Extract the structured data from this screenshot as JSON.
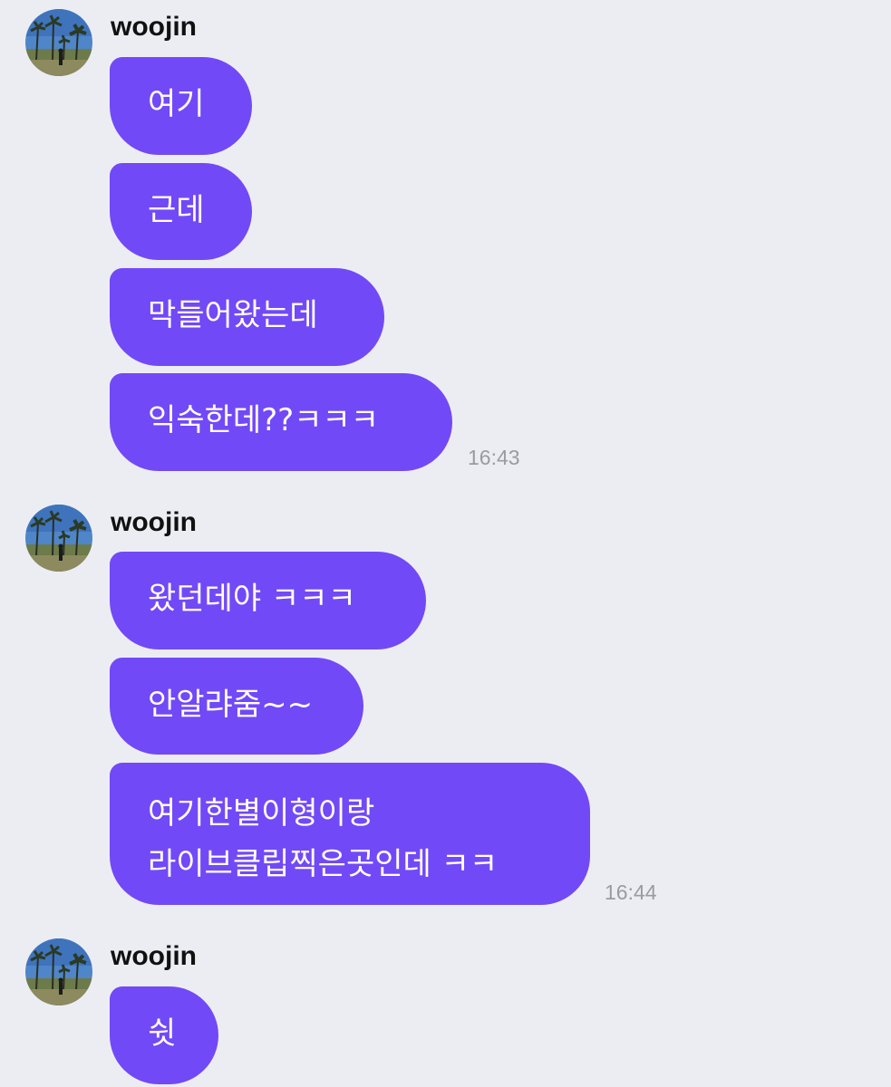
{
  "groups": [
    {
      "sender": "woojin",
      "avatar_icon": "palm-tree-photo-avatar",
      "messages": [
        "여기",
        "근데",
        "막들어왔는데",
        "익숙한데??ㅋㅋㅋ"
      ],
      "time": "16:43"
    },
    {
      "sender": "woojin",
      "avatar_icon": "palm-tree-photo-avatar",
      "messages": [
        "왔던데야 ㅋㅋㅋ",
        "안알랴줌~~",
        "여기한별이형이랑\n라이브클립찍은곳인데 ㅋㅋ"
      ],
      "time": "16:44"
    },
    {
      "sender": "woojin",
      "avatar_icon": "palm-tree-photo-avatar",
      "messages": [
        "쉿"
      ]
    }
  ],
  "colors": {
    "background": "#ecedf2",
    "bubble": "#7249f6",
    "bubble_text": "#ffffff",
    "time_text": "#9a9ba1"
  }
}
